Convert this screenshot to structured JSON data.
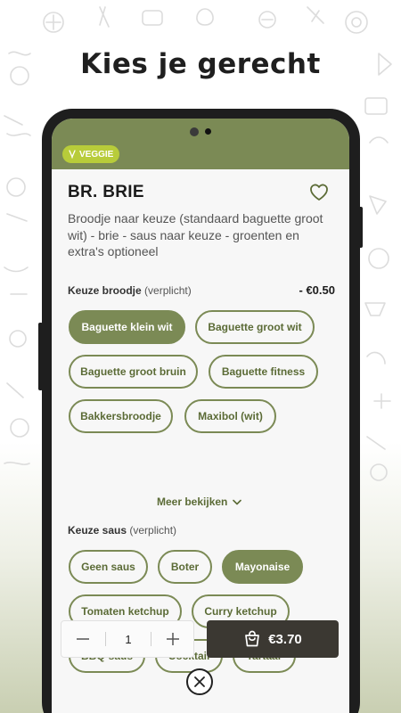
{
  "headline": "Kies je gerecht",
  "product": {
    "badge": "VEGGIE",
    "title": "BR. BRIE",
    "description": "Broodje naar keuze (standaard baguette groot wit) - brie - saus naar keuze - groenten en extra's optioneel"
  },
  "bread_section": {
    "label": "Keuze broodje",
    "required": "(verplicht)",
    "price_delta": "- €0.50",
    "options": [
      {
        "label": "Baguette klein wit",
        "selected": true
      },
      {
        "label": "Baguette groot wit",
        "selected": false
      },
      {
        "label": "Baguette groot bruin",
        "selected": false
      },
      {
        "label": "Baguette fitness",
        "selected": false
      },
      {
        "label": "Bakkersbroodje",
        "selected": false
      },
      {
        "label": "Maxibol (wit)",
        "selected": false
      }
    ],
    "more_label": "Meer bekijken"
  },
  "sauce_section": {
    "label": "Keuze saus",
    "required": "(verplicht)",
    "options": [
      {
        "label": "Geen saus",
        "selected": false
      },
      {
        "label": "Boter",
        "selected": false
      },
      {
        "label": "Mayonaise",
        "selected": true
      },
      {
        "label": "Tomaten ketchup",
        "selected": false
      },
      {
        "label": "Curry ketchup",
        "selected": false
      },
      {
        "label": "BBQ-saus",
        "selected": false
      },
      {
        "label": "Cocktail",
        "selected": false
      },
      {
        "label": "Tartaar",
        "selected": false
      }
    ]
  },
  "order": {
    "quantity": "1",
    "minus": "−",
    "plus": "+",
    "total": "€3.70"
  },
  "colors": {
    "brand_green": "#7b8a55",
    "veggie_badge": "#b8cc3a",
    "cart_button": "#3b3832"
  },
  "icons": [
    "heart-icon",
    "leaf-icon",
    "chevron-down-icon",
    "cart-icon",
    "close-icon"
  ]
}
